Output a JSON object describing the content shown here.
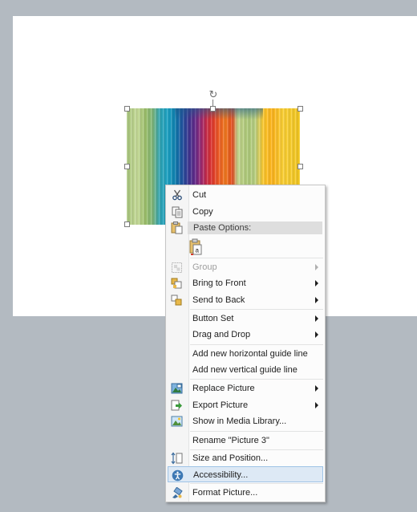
{
  "menu": {
    "cut": "Cut",
    "copy": "Copy",
    "paste_options": "Paste Options:",
    "group": "Group",
    "bring_to_front": "Bring to Front",
    "send_to_back": "Send to Back",
    "button_set": "Button Set",
    "drag_and_drop": "Drag and Drop",
    "add_horizontal_guide": "Add new horizontal guide line",
    "add_vertical_guide": "Add new vertical guide line",
    "replace_picture": "Replace Picture",
    "export_picture": "Export Picture",
    "show_in_media_library": "Show in Media Library...",
    "rename": "Rename \"Picture 3\"",
    "size_and_position": "Size and Position...",
    "accessibility": "Accessibility...",
    "format_picture": "Format Picture..."
  },
  "paste_options": [
    "Keep Text Only"
  ],
  "colors": {
    "canvas_bg": "#b3bac1",
    "page_bg": "#ffffff",
    "menu_highlight": "#dde9f5",
    "menu_highlight_border": "#9fc3e6"
  }
}
